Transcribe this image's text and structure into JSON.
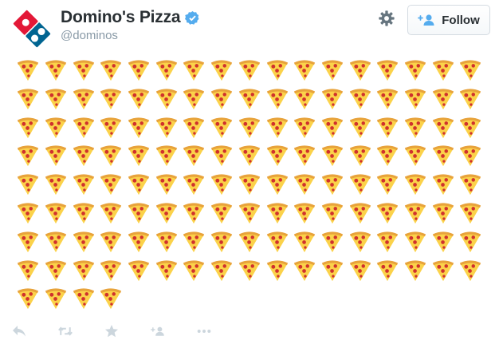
{
  "account": {
    "display_name": "Domino's Pizza",
    "handle": "@dominos",
    "verified": true
  },
  "header": {
    "follow_label": "Follow",
    "settings_icon": "gear-icon",
    "follow_icon": "add-user-icon"
  },
  "tweet": {
    "content_icon": "pizza-slice-emoji",
    "pizza_count": 140,
    "columns": 17
  },
  "actions": [
    {
      "icon": "reply-icon"
    },
    {
      "icon": "retweet-icon"
    },
    {
      "icon": "favorite-star-icon"
    },
    {
      "icon": "follow-user-icon"
    },
    {
      "icon": "more-dots-icon"
    }
  ],
  "colors": {
    "brand_blue": "#006491",
    "brand_red": "#e31837",
    "verified_blue": "#55acee",
    "crust": "#e8a33b",
    "cheese": "#fbd24a",
    "pepperoni": "#d0312d",
    "action_gray": "#ccd6dd"
  }
}
